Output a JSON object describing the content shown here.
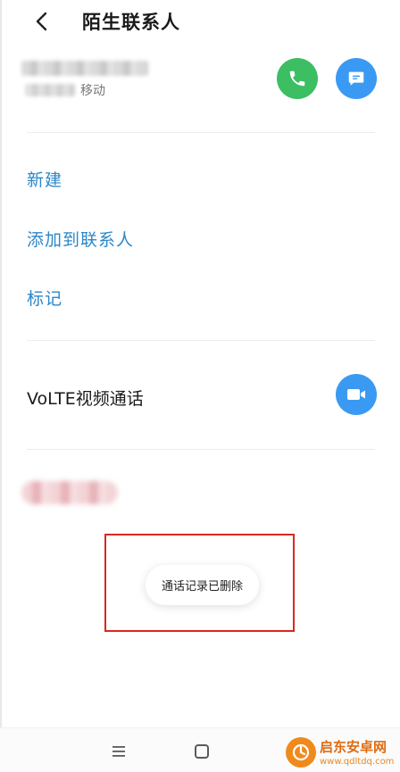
{
  "header": {
    "title": "陌生联系人"
  },
  "contact": {
    "carrier": "移动"
  },
  "actions": {
    "new": "新建",
    "add_to_contacts": "添加到联系人",
    "mark": "标记"
  },
  "volte": {
    "label": "VoLTE视频通话"
  },
  "toast": {
    "message": "通话记录已删除"
  },
  "watermark": {
    "title": "启东安卓网",
    "url": "www.qdltdq.com"
  },
  "colors": {
    "call_green": "#3cbe62",
    "action_blue": "#3a9af3",
    "link_blue": "#2b87c9",
    "highlight_red": "#d62a1e"
  },
  "icons": {
    "back": "chevron-left-icon",
    "call": "phone-icon",
    "message": "message-icon",
    "video": "video-camera-icon",
    "menu": "menu-icon",
    "home": "home-square-icon"
  }
}
